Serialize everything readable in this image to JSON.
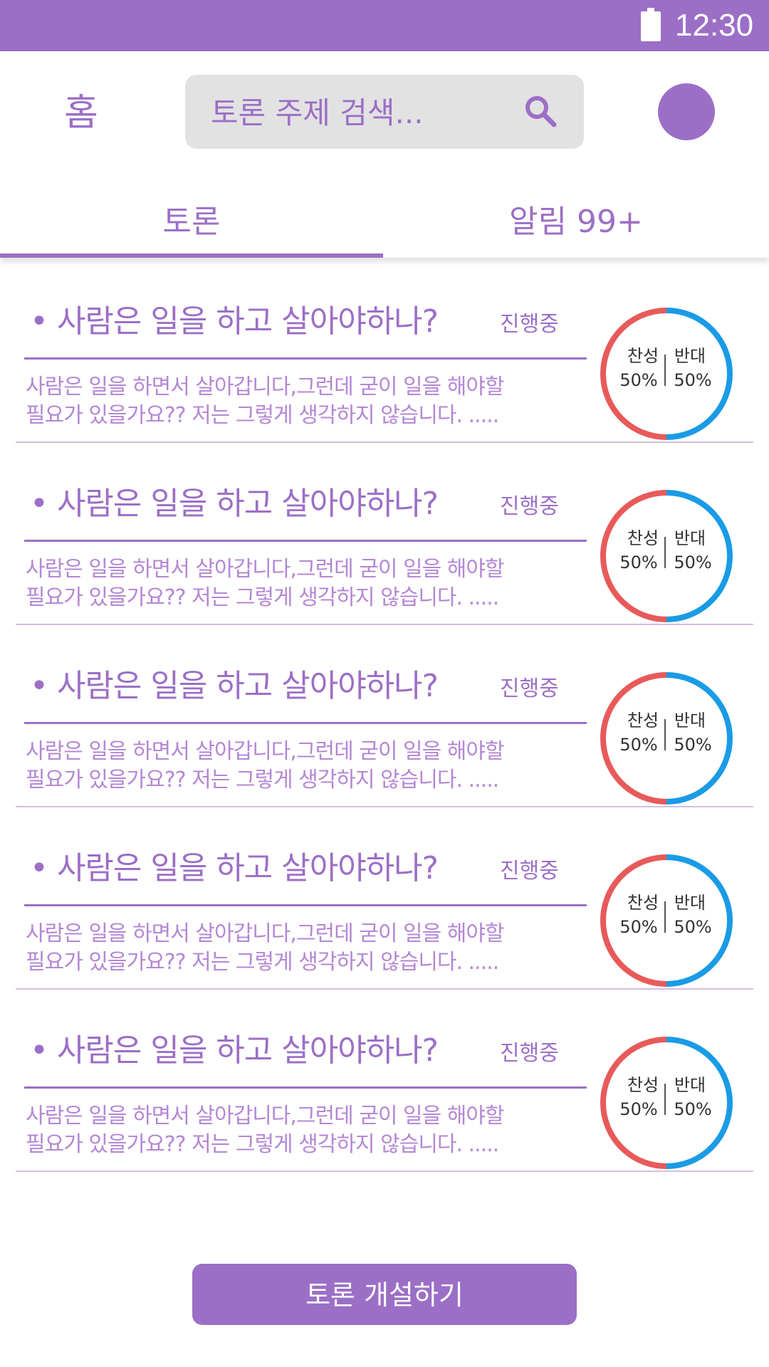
{
  "status_bar": {
    "time": "12:30"
  },
  "header": {
    "home_label": "홈",
    "search_placeholder": "토론 주제 검색...",
    "tabs": [
      {
        "label": "토론",
        "active": true
      },
      {
        "label": "알림 99+",
        "active": false
      }
    ]
  },
  "debates": [
    {
      "title": "• 사람은 일을 하고 살아야하나?",
      "status": "진행중",
      "description_line1": "사람은 일을 하면서 살아갑니다,그런데 굳이 일을 해야할",
      "description_line2": "필요가 있을가요?? 저는 그렇게 생각하지 않습니다.  .....",
      "agree_label": "찬성",
      "agree_value": "50%",
      "disagree_label": "반대",
      "disagree_value": "50%",
      "agree_ratio": 0.5
    },
    {
      "title": "• 사람은 일을 하고 살아야하나?",
      "status": "진행중",
      "description_line1": "사람은 일을 하면서 살아갑니다,그런데 굳이 일을 해야할",
      "description_line2": "필요가 있을가요?? 저는 그렇게 생각하지 않습니다.  .....",
      "agree_label": "찬성",
      "agree_value": "50%",
      "disagree_label": "반대",
      "disagree_value": "50%",
      "agree_ratio": 0.5
    },
    {
      "title": "• 사람은 일을 하고 살아야하나?",
      "status": "진행중",
      "description_line1": "사람은 일을 하면서 살아갑니다,그런데 굳이 일을 해야할",
      "description_line2": "필요가 있을가요?? 저는 그렇게 생각하지 않습니다.  .....",
      "agree_label": "찬성",
      "agree_value": "50%",
      "disagree_label": "반대",
      "disagree_value": "50%",
      "agree_ratio": 0.5
    },
    {
      "title": "• 사람은 일을 하고 살아야하나?",
      "status": "진행중",
      "description_line1": "사람은 일을 하면서 살아갑니다,그런데 굳이 일을 해야할",
      "description_line2": "필요가 있을가요?? 저는 그렇게 생각하지 않습니다.  .....",
      "agree_label": "찬성",
      "agree_value": "50%",
      "disagree_label": "반대",
      "disagree_value": "50%",
      "agree_ratio": 0.5
    },
    {
      "title": "• 사람은 일을 하고 살아야하나?",
      "status": "진행중",
      "description_line1": "사람은 일을 하면서 살아갑니다,그런데 굳이 일을 해야할",
      "description_line2": "필요가 있을가요?? 저는 그렇게 생각하지 않습니다.  .....",
      "agree_label": "찬성",
      "agree_value": "50%",
      "disagree_label": "반대",
      "disagree_value": "50%",
      "agree_ratio": 0.5
    }
  ],
  "cta_label": "토론 개설하기",
  "colors": {
    "primary": "#9c6fc6",
    "agree": "#e85a5a",
    "disagree": "#1a9be6"
  },
  "icons": {
    "search": "search-icon",
    "battery": "battery-icon"
  }
}
